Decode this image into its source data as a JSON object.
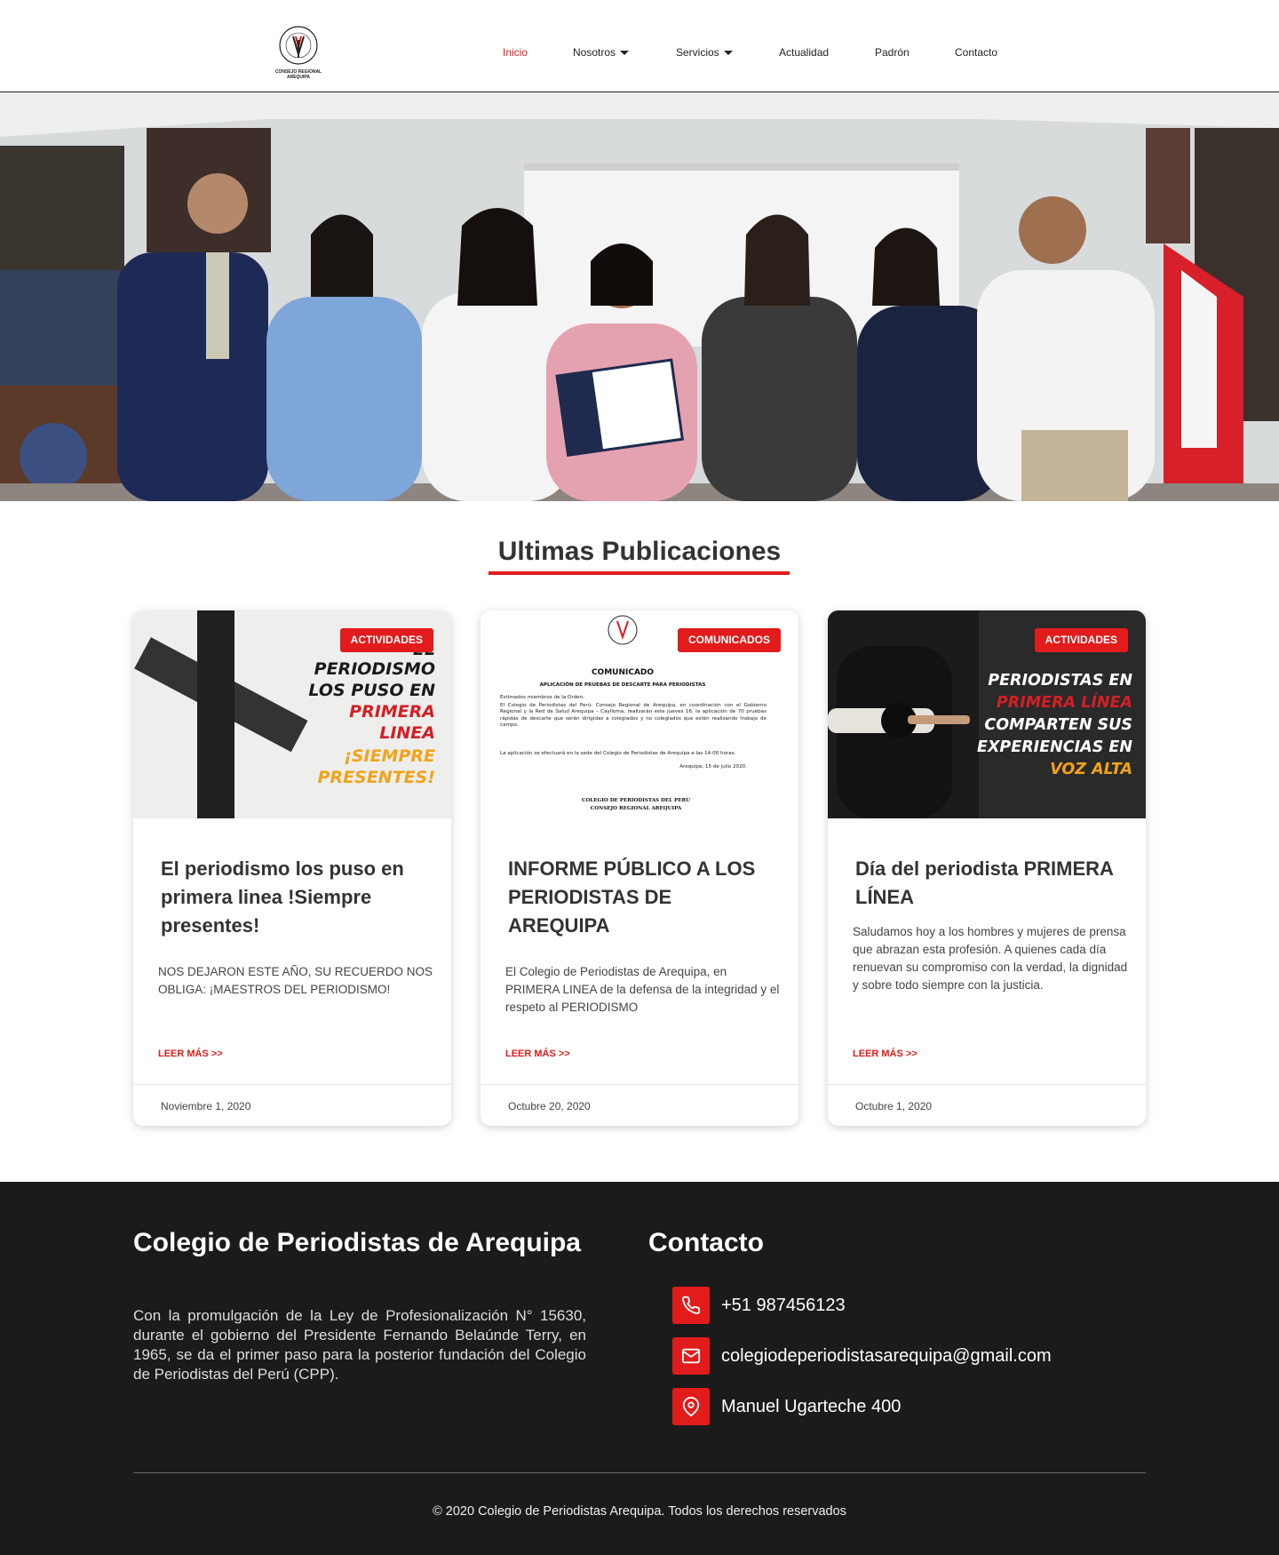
{
  "header": {
    "logo_text": "CONSEJO REGIONAL AREQUIPA",
    "logo_ring_text": "COLEGIO DE PERIODISTAS DEL PERÚ",
    "nav": [
      {
        "label": "Inicio",
        "active": true
      },
      {
        "label": "Nosotros",
        "dropdown": true
      },
      {
        "label": "Servicios",
        "dropdown": true
      },
      {
        "label": "Actualidad"
      },
      {
        "label": "Padrón"
      },
      {
        "label": "Contacto"
      }
    ]
  },
  "section": {
    "title": "Ultimas Publicaciones"
  },
  "cards": [
    {
      "badge": "ACTIVIDADES",
      "image_lines": [
        "EL",
        "PERIODISMO",
        "LOS PUSO EN",
        "PRIMERA",
        "LINEA",
        "¡SIEMPRE",
        "PRESENTES!"
      ],
      "title": "El periodismo los puso en primera linea !Siempre presentes!",
      "excerpt": "NOS DEJARON ESTE AÑO, SU RECUERDO NOS OBLIGA: ¡MAESTROS DEL PERIODISMO!",
      "read_more": "LEER MÁS >>",
      "date": "Noviembre 1, 2020"
    },
    {
      "badge": "COMUNICADOS",
      "image_lines": [
        "COMUNICADO",
        "APLICACIÓN DE PRUEBAS DE DESCARTE PARA PERIODISTAS",
        "Estimados miembros de la Orden:",
        "El Colegio de Periodistas del Perú- Consejo Regional de Arequipa, en coordinación con el Gobierno Regional y la Red de Salud Arequipa – Caylloma, realizarán este jueves 16, la aplicación de 70 pruebas rápidas de descarte que serán dirigidas a colegiados y no colegiados que estén realizando trabajo de campo.",
        "La aplicación se efectuará en la sede del Colegio de Periodistas de Arequipa a las 14:00 horas.",
        "Arequipa, 15 de julio 2020.",
        "COLEGIO DE PERIODISTAS DEL PERÚ",
        "CONSEJO REGIONAL AREQUIPA"
      ],
      "title": "INFORME PÚBLICO A LOS PERIODISTAS DE AREQUIPA",
      "excerpt": "El Colegio de Periodistas de Arequipa, en PRIMERA LINEA de la defensa de la integridad y el respeto al PERIODISMO",
      "read_more": "LEER MÁS >>",
      "date": "Octubre 20, 2020"
    },
    {
      "badge": "ACTIVIDADES",
      "image_lines": [
        "PERIODISTAS EN",
        "PRIMERA LÍNEA",
        "COMPARTEN SUS",
        "EXPERIENCIAS EN",
        "VOZ ALTA"
      ],
      "title": "Día del periodista PRIMERA LÍNEA",
      "excerpt": "Saludamos hoy a los hombres y mujeres de prensa que abrazan esta profesión. A quienes cada día renuevan su compromiso con la verdad, la dignidad y sobre todo siempre con la justicia.",
      "read_more": "LEER MÁS >>",
      "date": "Octubre 1, 2020"
    }
  ],
  "footer": {
    "about_title": "Colegio de Periodistas de Arequipa",
    "about_text": "Con la promulgación de la Ley de Profesionalización N° 15630, durante el gobierno del Presidente Fernando Belaúnde Terry, en 1965, se da el primer paso para la posterior fundación del Colegio de Periodistas del Perú (CPP).",
    "contact_title": "Contacto",
    "contacts": [
      {
        "icon": "phone-icon",
        "text": "+51 987456123"
      },
      {
        "icon": "mail-icon",
        "text": "colegiodeperiodistasarequipa@gmail.com"
      },
      {
        "icon": "location-icon",
        "text": "Manuel Ugarteche 400"
      }
    ],
    "copyright": "© 2020 Colegio de Periodistas Arequipa. Todos los derechos reservados"
  },
  "colors": {
    "accent": "#e21b1b",
    "footer_bg": "#1b1b1c"
  }
}
